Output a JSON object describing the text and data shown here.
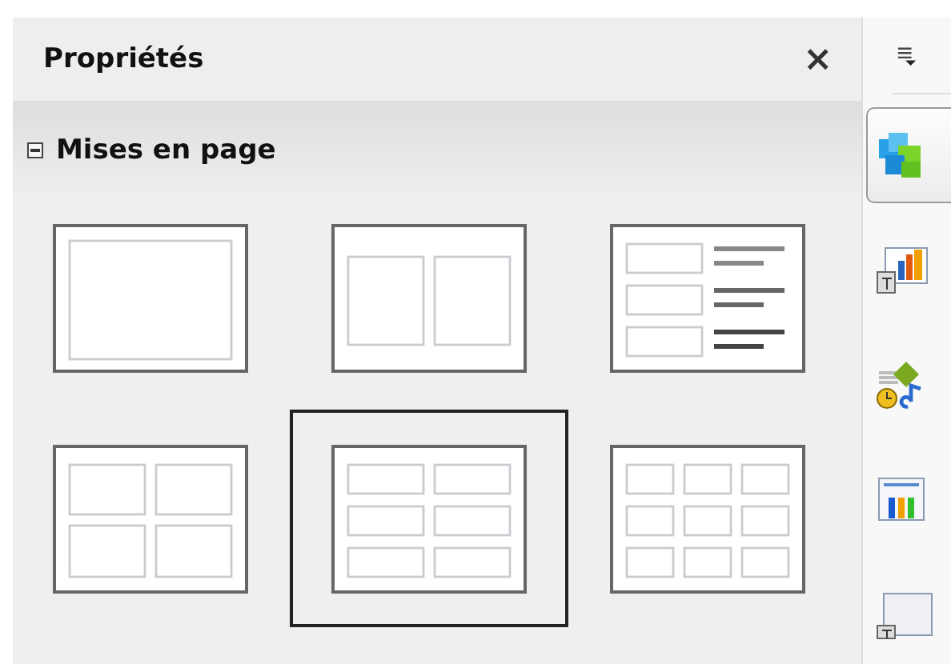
{
  "panel": {
    "title": "Propriétés",
    "close": "×"
  },
  "section": {
    "title": "Mises en page",
    "expanded": true
  },
  "layouts": [
    {
      "kind": "blank",
      "selected": false
    },
    {
      "kind": "two-columns",
      "selected": false
    },
    {
      "kind": "list",
      "selected": false
    },
    {
      "kind": "four",
      "selected": false
    },
    {
      "kind": "six",
      "selected": true
    },
    {
      "kind": "nine",
      "selected": false
    }
  ],
  "sidebar": {
    "tabs": [
      {
        "kind": "cube",
        "selected": true
      },
      {
        "kind": "chart",
        "selected": false
      },
      {
        "kind": "animation",
        "selected": false
      },
      {
        "kind": "gallery",
        "selected": false
      },
      {
        "kind": "slide",
        "selected": false
      }
    ]
  }
}
